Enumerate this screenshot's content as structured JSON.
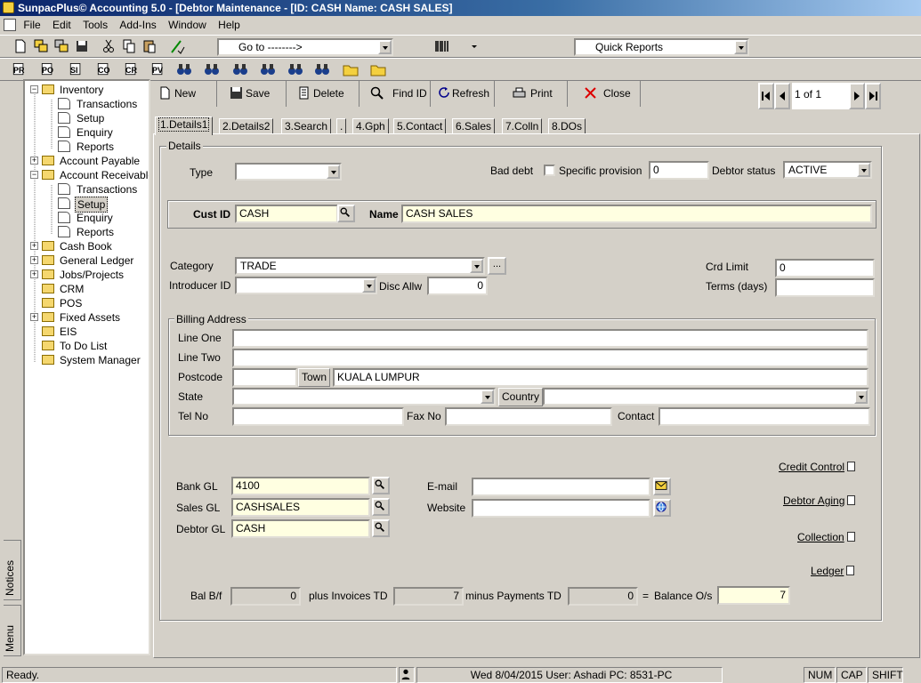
{
  "window": {
    "title": "SunpacPlus© Accounting 5.0 - [Debtor Maintenance - [ID: CASH Name: CASH SALES]"
  },
  "menu": [
    "File",
    "Edit",
    "Tools",
    "Add-Ins",
    "Window",
    "Help"
  ],
  "toolbar": {
    "goto_value": "Go to -------->",
    "quick_reports": "Quick Reports",
    "doc_buttons": [
      "PR",
      "PO",
      "SI",
      "CO",
      "CR",
      "PV"
    ]
  },
  "tree": {
    "items": [
      {
        "label": "Inventory",
        "level": 0,
        "expander": "−",
        "kind": "folder"
      },
      {
        "label": "Transactions",
        "level": 1,
        "kind": "doc"
      },
      {
        "label": "Setup",
        "level": 1,
        "kind": "doc"
      },
      {
        "label": "Enquiry",
        "level": 1,
        "kind": "doc"
      },
      {
        "label": "Reports",
        "level": 1,
        "kind": "doc"
      },
      {
        "label": "Account Payable",
        "level": 0,
        "expander": "+",
        "kind": "folder"
      },
      {
        "label": "Account Receivable",
        "level": 0,
        "expander": "−",
        "kind": "folder"
      },
      {
        "label": "Transactions",
        "level": 1,
        "kind": "doc"
      },
      {
        "label": "Setup",
        "level": 1,
        "kind": "doc",
        "selected": true
      },
      {
        "label": "Enquiry",
        "level": 1,
        "kind": "doc"
      },
      {
        "label": "Reports",
        "level": 1,
        "kind": "doc"
      },
      {
        "label": "Cash Book",
        "level": 0,
        "expander": "+",
        "kind": "folder"
      },
      {
        "label": "General Ledger",
        "level": 0,
        "expander": "+",
        "kind": "folder"
      },
      {
        "label": "Jobs/Projects",
        "level": 0,
        "expander": "+",
        "kind": "folder"
      },
      {
        "label": "CRM",
        "level": 0,
        "kind": "folder"
      },
      {
        "label": "POS",
        "level": 0,
        "kind": "folder"
      },
      {
        "label": "Fixed Assets",
        "level": 0,
        "expander": "+",
        "kind": "folder"
      },
      {
        "label": "EIS",
        "level": 0,
        "kind": "folder"
      },
      {
        "label": "To Do List",
        "level": 0,
        "kind": "folder"
      },
      {
        "label": "System Manager",
        "level": 0,
        "kind": "folder"
      }
    ]
  },
  "sidetabs": {
    "notices": "Notices",
    "menu": "Menu"
  },
  "actions": {
    "new": "New",
    "save": "Save",
    "delete": "Delete",
    "find_id": "Find ID",
    "refresh": "Refresh",
    "print": "Print",
    "close": "Close"
  },
  "nav": {
    "record": "1 of 1"
  },
  "tabs": [
    "1.Details1",
    "2.Details2",
    "3.Search",
    ".",
    "4.Gph",
    "5.Contact",
    "6.Sales",
    "7.Colln",
    "8.DOs"
  ],
  "details": {
    "group_label": "Details",
    "type_label": "Type",
    "type_value": "",
    "bad_debt_label": "Bad debt",
    "specific_provision_label": "Specific provision",
    "specific_provision_value": "0",
    "debtor_status_label": "Debtor status",
    "debtor_status_value": "ACTIVE",
    "cust_id_label": "Cust ID",
    "cust_id_value": "CASH",
    "name_label": "Name",
    "name_value": "CASH SALES",
    "category_label": "Category",
    "category_value": "TRADE",
    "category_more": "...",
    "introducer_label": "Introducer ID",
    "introducer_value": "",
    "disc_allw_label": "Disc Allw",
    "disc_allw_value": "0",
    "crd_limit_label": "Crd Limit",
    "crd_limit_value": "0",
    "terms_label": "Terms (days)",
    "terms_value": ""
  },
  "billing": {
    "group_label": "Billing Address",
    "line_one_label": "Line One",
    "line_one_value": "",
    "line_two_label": "Line Two",
    "line_two_value": "",
    "postcode_label": "Postcode",
    "postcode_value": "",
    "town_label": "Town",
    "town_value": "KUALA LUMPUR",
    "state_label": "State",
    "state_value": "",
    "country_label": "Country",
    "country_value": "",
    "tel_label": "Tel No",
    "tel_value": "",
    "fax_label": "Fax No",
    "fax_value": "",
    "contact_label": "Contact",
    "contact_value": ""
  },
  "gl": {
    "bank_label": "Bank GL",
    "bank_value": "4100",
    "sales_label": "Sales GL",
    "sales_value": "CASHSALES",
    "debtor_label": "Debtor GL",
    "debtor_value": "CASH",
    "email_label": "E-mail",
    "email_value": "",
    "website_label": "Website",
    "website_value": ""
  },
  "links": {
    "credit_control": "Credit Control",
    "debtor_aging": "Debtor Aging",
    "collection": "Collection",
    "ledger": "Ledger"
  },
  "balance": {
    "bal_bf_label": "Bal B/f",
    "bal_bf_value": "0",
    "plus_invoices_label": "plus Invoices TD",
    "plus_invoices_value": "7",
    "minus_payments_label": "minus Payments TD",
    "minus_payments_value": "0",
    "equals": "=",
    "balance_label": "Balance O/s",
    "balance_value": "7"
  },
  "status": {
    "ready": "Ready.",
    "info": "Wed 8/04/2015 User: Ashadi PC: 8531-PC",
    "num": "NUM",
    "cap": "CAP",
    "shift": "SHIFT"
  }
}
